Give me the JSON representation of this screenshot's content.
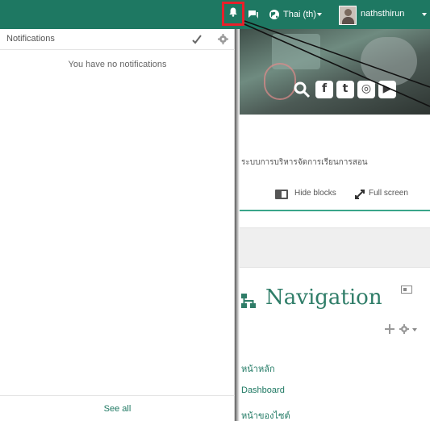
{
  "topbar": {
    "language_label": "Thai (th)",
    "user_label": "nathsthirun"
  },
  "icons": {
    "bell": "bell-icon",
    "chat": "chat-icon",
    "globe": "globe-icon",
    "check": "check-icon",
    "gear": "gear-icon"
  },
  "colors": {
    "brand": "#1e7862",
    "highlight": "#e8202a",
    "accent": "#3aa58a"
  },
  "notifications": {
    "title": "Notifications",
    "empty_message": "You have no notifications",
    "see_all_label": "See all"
  },
  "page": {
    "thai_text": "ระบบการบริหารจัดการเรียนการสอน",
    "hide_blocks_label": "Hide blocks",
    "full_screen_label": "Full screen",
    "navigation_title": "Navigation",
    "nav_links": [
      "หน้าหลัก",
      "Dashboard",
      "หน้าของไซต์"
    ]
  }
}
